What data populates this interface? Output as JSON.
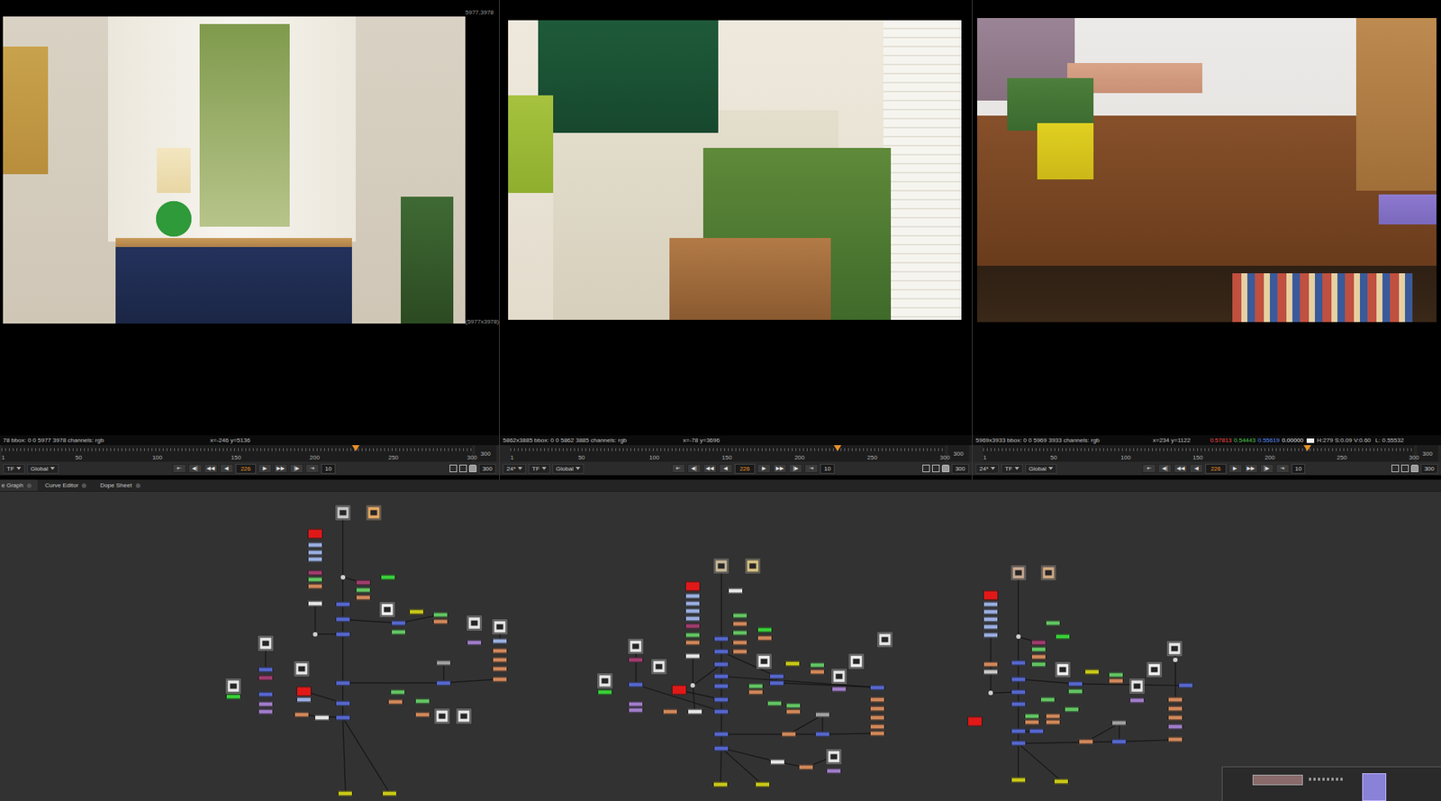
{
  "viewers": [
    {
      "corner_labels": [
        "5977,3978",
        "(5977x3978)"
      ],
      "info": {
        "left": "78  bbox: 0 0 5977 3978 channels: rgb",
        "coords": "x=-246 y=5136"
      },
      "ruler": {
        "ticks": [
          "1",
          "50",
          "100",
          "150",
          "200",
          "250",
          "300"
        ],
        "end": "300",
        "playhead": 0.7525
      },
      "controls": {
        "tf": "TF",
        "global": "Global",
        "transport_left": [
          "⇤",
          "◀|",
          "◀◀",
          "◀"
        ],
        "frame": "226",
        "transport_right": [
          "▶",
          "▶▶",
          "|▶",
          "⇥"
        ],
        "skip": "10",
        "end": "300"
      }
    },
    {
      "corner_labels": [],
      "info": {
        "left": "5862x3885  bbox: 0 0 5862 3885 channels: rgb",
        "coords": "x=-78 y=3696"
      },
      "ruler": {
        "ticks": [
          "1",
          "50",
          "100",
          "150",
          "200",
          "250",
          "300"
        ],
        "end": "300",
        "playhead": 0.7525
      },
      "controls": {
        "fps": "24*",
        "tf": "TF",
        "global": "Global",
        "transport_left": [
          "⇤",
          "◀|",
          "◀◀",
          "◀"
        ],
        "frame": "226",
        "transport_right": [
          "▶",
          "▶▶",
          "|▶",
          "⇥"
        ],
        "skip": "10",
        "end": "300"
      }
    },
    {
      "corner_labels": [],
      "info": {
        "left": "5969x3933  bbox: 0 0 5969 3933 channels: rgb",
        "coords": "x=234 y=1122",
        "pixel": [
          {
            "text": "0.57813",
            "color": "#ff4a4a"
          },
          {
            "text": "0.54443",
            "color": "#4ad04a"
          },
          {
            "text": "0.55619",
            "color": "#5a8cff"
          },
          {
            "text": "0.00000",
            "color": "#e0e0e0"
          }
        ],
        "hsv": "H:279 S:0.09 V:0.60",
        "lum": "L: 0.55532"
      },
      "ruler": {
        "ticks": [
          "1",
          "50",
          "100",
          "150",
          "200",
          "250",
          "300"
        ],
        "end": "300",
        "playhead": 0.7525
      },
      "controls": {
        "fps": "24*",
        "tf": "TF",
        "global": "Global",
        "transport_left": [
          "⇤",
          "◀|",
          "◀◀",
          "◀"
        ],
        "frame": "226",
        "transport_right": [
          "▶",
          "▶▶",
          "|▶",
          "⇥"
        ],
        "skip": "10",
        "end": "300"
      }
    }
  ],
  "tabs": [
    {
      "label": "e Graph",
      "selected": true
    },
    {
      "label": "Curve Editor",
      "selected": false
    },
    {
      "label": "Dope Sheet",
      "selected": false
    }
  ],
  "node_graph": {
    "graphs": [
      {
        "nodes": [
          {
            "kind": "thumb",
            "color": "#c8c8c8"
          },
          {
            "kind": "thumb",
            "color": "#e8a860"
          },
          {
            "kind": "tall",
            "color": "#e01818"
          },
          {
            "kind": "node",
            "color": "#9aaee0"
          },
          {
            "kind": "node",
            "color": "#9aaee0"
          },
          {
            "kind": "node",
            "color": "#9aaee0"
          },
          {
            "kind": "node",
            "color": "#a03c6e"
          },
          {
            "kind": "node",
            "color": "#62c462"
          },
          {
            "kind": "node",
            "color": "#d0875a"
          },
          {
            "kind": "node",
            "color": "#e6e6e6"
          },
          {
            "kind": "dot",
            "color": "#d0d0d0"
          },
          {
            "kind": "node",
            "color": "#38d038"
          },
          {
            "kind": "node",
            "color": "#a03c6e"
          },
          {
            "kind": "node",
            "color": "#62c462"
          },
          {
            "kind": "node",
            "color": "#d0875a"
          },
          {
            "kind": "node",
            "color": "#5566cc"
          },
          {
            "kind": "thumb",
            "color": "#f0f0f0"
          },
          {
            "kind": "node",
            "color": "#5566cc"
          },
          {
            "kind": "node",
            "color": "#5566cc"
          },
          {
            "kind": "node",
            "color": "#c8c818"
          },
          {
            "kind": "node",
            "color": "#62c462"
          },
          {
            "kind": "node",
            "color": "#d0875a"
          },
          {
            "kind": "node",
            "color": "#5566cc"
          },
          {
            "kind": "node",
            "color": "#62c462"
          },
          {
            "kind": "dot",
            "color": "#d0d0d0"
          },
          {
            "kind": "thumb",
            "color": "#e6e6e6"
          },
          {
            "kind": "thumb",
            "color": "#e6e6e6"
          },
          {
            "kind": "node",
            "color": "#5566cc"
          },
          {
            "kind": "node",
            "color": "#a03c6e"
          },
          {
            "kind": "thumb",
            "color": "#e6e6e6"
          },
          {
            "kind": "node",
            "color": "#38d038"
          },
          {
            "kind": "node",
            "color": "#5566cc"
          },
          {
            "kind": "node",
            "color": "#a07cc8"
          },
          {
            "kind": "node",
            "color": "#a07cc8"
          },
          {
            "kind": "tall",
            "color": "#e01818"
          },
          {
            "kind": "node",
            "color": "#9aaee0"
          },
          {
            "kind": "node",
            "color": "#5566cc"
          },
          {
            "kind": "node",
            "color": "#5566cc"
          },
          {
            "kind": "node",
            "color": "#5566cc"
          },
          {
            "kind": "node",
            "color": "#d0875a"
          },
          {
            "kind": "node",
            "color": "#e6e6e6"
          },
          {
            "kind": "node",
            "color": "#62c462"
          },
          {
            "kind": "node",
            "color": "#d0875a"
          },
          {
            "kind": "node",
            "color": "#62c462"
          },
          {
            "kind": "node",
            "color": "#d0875a"
          },
          {
            "kind": "node",
            "color": "#a0a0a0"
          },
          {
            "kind": "node",
            "color": "#5566cc"
          },
          {
            "kind": "thumb",
            "color": "#e6e6e6"
          },
          {
            "kind": "thumb",
            "color": "#e6e6e6"
          },
          {
            "kind": "node",
            "color": "#9aaee0"
          },
          {
            "kind": "node",
            "color": "#d0875a"
          },
          {
            "kind": "node",
            "color": "#d0875a"
          },
          {
            "kind": "node",
            "color": "#d0875a"
          },
          {
            "kind": "node",
            "color": "#d0875a"
          },
          {
            "kind": "thumb",
            "color": "#e6e6e6"
          },
          {
            "kind": "thumb",
            "color": "#e6e6e6"
          },
          {
            "kind": "node",
            "color": "#c8c818"
          },
          {
            "kind": "node",
            "color": "#c8c818"
          },
          {
            "kind": "node",
            "color": "#a07cc8"
          }
        ]
      },
      {
        "nodes": [
          {
            "kind": "thumb",
            "color": "#c8b898"
          },
          {
            "kind": "thumb",
            "color": "#d8c080"
          },
          {
            "kind": "tall",
            "color": "#e01818"
          },
          {
            "kind": "node",
            "color": "#9aaee0"
          },
          {
            "kind": "node",
            "color": "#9aaee0"
          },
          {
            "kind": "node",
            "color": "#9aaee0"
          },
          {
            "kind": "node",
            "color": "#9aaee0"
          },
          {
            "kind": "node",
            "color": "#a03c6e"
          },
          {
            "kind": "node",
            "color": "#62c462"
          },
          {
            "kind": "node",
            "color": "#d0875a"
          },
          {
            "kind": "node",
            "color": "#e6e6e6"
          },
          {
            "kind": "node",
            "color": "#e6e6e6"
          },
          {
            "kind": "dot",
            "color": "#d0d0d0"
          },
          {
            "kind": "node",
            "color": "#5566cc"
          },
          {
            "kind": "node",
            "color": "#5566cc"
          },
          {
            "kind": "node",
            "color": "#5566cc"
          },
          {
            "kind": "node",
            "color": "#5566cc"
          },
          {
            "kind": "node",
            "color": "#5566cc"
          },
          {
            "kind": "node",
            "color": "#5566cc"
          },
          {
            "kind": "node",
            "color": "#5566cc"
          },
          {
            "kind": "node",
            "color": "#5566cc"
          },
          {
            "kind": "node",
            "color": "#5566cc"
          },
          {
            "kind": "node",
            "color": "#62c462"
          },
          {
            "kind": "node",
            "color": "#d0875a"
          },
          {
            "kind": "node",
            "color": "#62c462"
          },
          {
            "kind": "node",
            "color": "#d0875a"
          },
          {
            "kind": "node",
            "color": "#d0875a"
          },
          {
            "kind": "node",
            "color": "#38d038"
          },
          {
            "kind": "node",
            "color": "#d0875a"
          },
          {
            "kind": "thumb",
            "color": "#f0f0f0"
          },
          {
            "kind": "node",
            "color": "#c8c818"
          },
          {
            "kind": "node",
            "color": "#62c462"
          },
          {
            "kind": "node",
            "color": "#d0875a"
          },
          {
            "kind": "thumb",
            "color": "#f0f0f0"
          },
          {
            "kind": "node",
            "color": "#5566cc"
          },
          {
            "kind": "node",
            "color": "#5566cc"
          },
          {
            "kind": "thumb",
            "color": "#e6e6e6"
          },
          {
            "kind": "node",
            "color": "#a07cc8"
          },
          {
            "kind": "node",
            "color": "#62c462"
          },
          {
            "kind": "node",
            "color": "#d0875a"
          },
          {
            "kind": "node",
            "color": "#62c462"
          },
          {
            "kind": "node",
            "color": "#62c462"
          },
          {
            "kind": "node",
            "color": "#d0875a"
          },
          {
            "kind": "thumb",
            "color": "#e6e6e6"
          },
          {
            "kind": "node",
            "color": "#5566cc"
          },
          {
            "kind": "node",
            "color": "#d0875a"
          },
          {
            "kind": "node",
            "color": "#d0875a"
          },
          {
            "kind": "node",
            "color": "#d0875a"
          },
          {
            "kind": "node",
            "color": "#d0875a"
          },
          {
            "kind": "node",
            "color": "#d0875a"
          },
          {
            "kind": "node",
            "color": "#a0a0a0"
          },
          {
            "kind": "node",
            "color": "#5566cc"
          },
          {
            "kind": "node",
            "color": "#d0875a"
          },
          {
            "kind": "thumb",
            "color": "#e6e6e6"
          },
          {
            "kind": "node",
            "color": "#a03c6e"
          },
          {
            "kind": "node",
            "color": "#5566cc"
          },
          {
            "kind": "node",
            "color": "#a07cc8"
          },
          {
            "kind": "node",
            "color": "#a07cc8"
          },
          {
            "kind": "thumb",
            "color": "#e6e6e6"
          },
          {
            "kind": "node",
            "color": "#38d038"
          },
          {
            "kind": "thumb",
            "color": "#e6e6e6"
          },
          {
            "kind": "tall",
            "color": "#e01818"
          },
          {
            "kind": "node",
            "color": "#d0875a"
          },
          {
            "kind": "node",
            "color": "#e6e6e6"
          },
          {
            "kind": "node",
            "color": "#e6e6e6"
          },
          {
            "kind": "node",
            "color": "#d0875a"
          },
          {
            "kind": "thumb",
            "color": "#e6e6e6"
          },
          {
            "kind": "node",
            "color": "#a07cc8"
          },
          {
            "kind": "node",
            "color": "#c8c818"
          },
          {
            "kind": "node",
            "color": "#c8c818"
          }
        ]
      },
      {
        "nodes": [
          {
            "kind": "thumb",
            "color": "#c8a890"
          },
          {
            "kind": "thumb",
            "color": "#d0a880"
          },
          {
            "kind": "tall",
            "color": "#e01818"
          },
          {
            "kind": "node",
            "color": "#9aaee0"
          },
          {
            "kind": "node",
            "color": "#9aaee0"
          },
          {
            "kind": "node",
            "color": "#9aaee0"
          },
          {
            "kind": "node",
            "color": "#9aaee0"
          },
          {
            "kind": "node",
            "color": "#d0875a"
          },
          {
            "kind": "node",
            "color": "#c8c8c8"
          },
          {
            "kind": "dot",
            "color": "#d0d0d0"
          },
          {
            "kind": "dot",
            "color": "#d0d0d0"
          },
          {
            "kind": "node",
            "color": "#5566cc"
          },
          {
            "kind": "node",
            "color": "#5566cc"
          },
          {
            "kind": "node",
            "color": "#5566cc"
          },
          {
            "kind": "node",
            "color": "#5566cc"
          },
          {
            "kind": "node",
            "color": "#5566cc"
          },
          {
            "kind": "node",
            "color": "#5566cc"
          },
          {
            "kind": "node",
            "color": "#62c462"
          },
          {
            "kind": "node",
            "color": "#38d038"
          },
          {
            "kind": "node",
            "color": "#a03c6e"
          },
          {
            "kind": "node",
            "color": "#62c462"
          },
          {
            "kind": "node",
            "color": "#d0875a"
          },
          {
            "kind": "node",
            "color": "#62c462"
          },
          {
            "kind": "thumb",
            "color": "#f0f0f0"
          },
          {
            "kind": "node",
            "color": "#c8c818"
          },
          {
            "kind": "node",
            "color": "#62c462"
          },
          {
            "kind": "node",
            "color": "#d0875a"
          },
          {
            "kind": "thumb",
            "color": "#f0f0f0"
          },
          {
            "kind": "node",
            "color": "#5566cc"
          },
          {
            "kind": "node",
            "color": "#62c462"
          },
          {
            "kind": "thumb",
            "color": "#e6e6e6"
          },
          {
            "kind": "node",
            "color": "#a07cc8"
          },
          {
            "kind": "node",
            "color": "#62c462"
          },
          {
            "kind": "node",
            "color": "#62c462"
          },
          {
            "kind": "node",
            "color": "#62c462"
          },
          {
            "kind": "node",
            "color": "#d0875a"
          },
          {
            "kind": "node",
            "color": "#d0875a"
          },
          {
            "kind": "node",
            "color": "#d0875a"
          },
          {
            "kind": "thumb",
            "color": "#e6e6e6"
          },
          {
            "kind": "dot",
            "color": "#d0d0d0"
          },
          {
            "kind": "node",
            "color": "#5566cc"
          },
          {
            "kind": "node",
            "color": "#d0875a"
          },
          {
            "kind": "node",
            "color": "#d0875a"
          },
          {
            "kind": "node",
            "color": "#d0875a"
          },
          {
            "kind": "node",
            "color": "#a07cc8"
          },
          {
            "kind": "node",
            "color": "#d0875a"
          },
          {
            "kind": "node",
            "color": "#a0a0a0"
          },
          {
            "kind": "node",
            "color": "#5566cc"
          },
          {
            "kind": "node",
            "color": "#d0875a"
          },
          {
            "kind": "node",
            "color": "#5566cc"
          },
          {
            "kind": "tall",
            "color": "#e01818"
          },
          {
            "kind": "node",
            "color": "#c8c818"
          },
          {
            "kind": "node",
            "color": "#c8c818"
          },
          {
            "kind": "node",
            "color": "#9aaee0"
          }
        ]
      }
    ]
  }
}
